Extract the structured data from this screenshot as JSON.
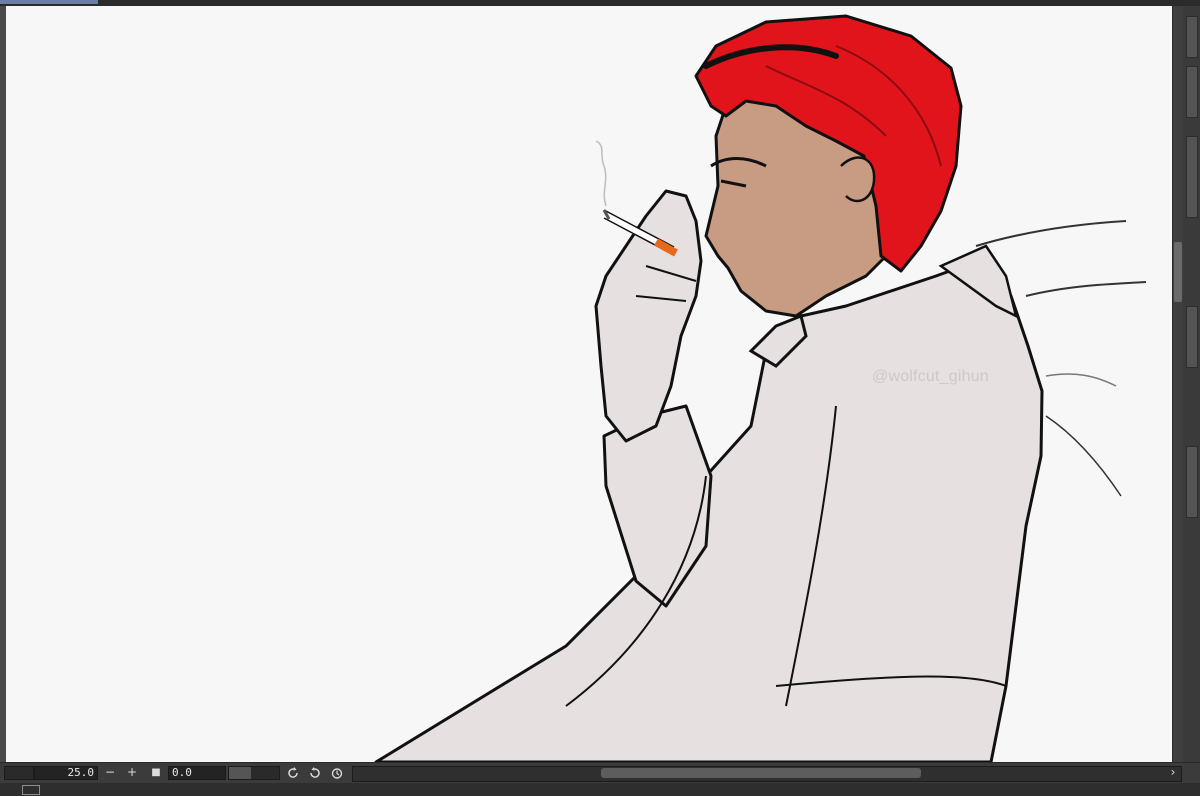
{
  "status_bar": {
    "zoom_value": "25.0",
    "minus_label": "−",
    "plus_label": "+",
    "stop_label": "■",
    "angle_value": "0.0",
    "rotate_left_icon": "rotate-ccw-icon",
    "rotate_right_icon": "rotate-cw-icon",
    "reset_icon": "reset-rotation-icon",
    "scroll_left_label": "‹",
    "scroll_right_label": "›"
  },
  "canvas": {
    "watermark_text": "@wolfcut_gihun",
    "colors": {
      "paper": "#f7f7f7",
      "hair": "#e1141c",
      "skin": "#c79c83",
      "coat": "#e6e0e1",
      "line": "#111111",
      "ember": "#e56a1c"
    }
  },
  "colors": {
    "ui_dark": "#3b3b3b",
    "ui_field": "#232323",
    "accent_tab": "#6a7fa8"
  }
}
